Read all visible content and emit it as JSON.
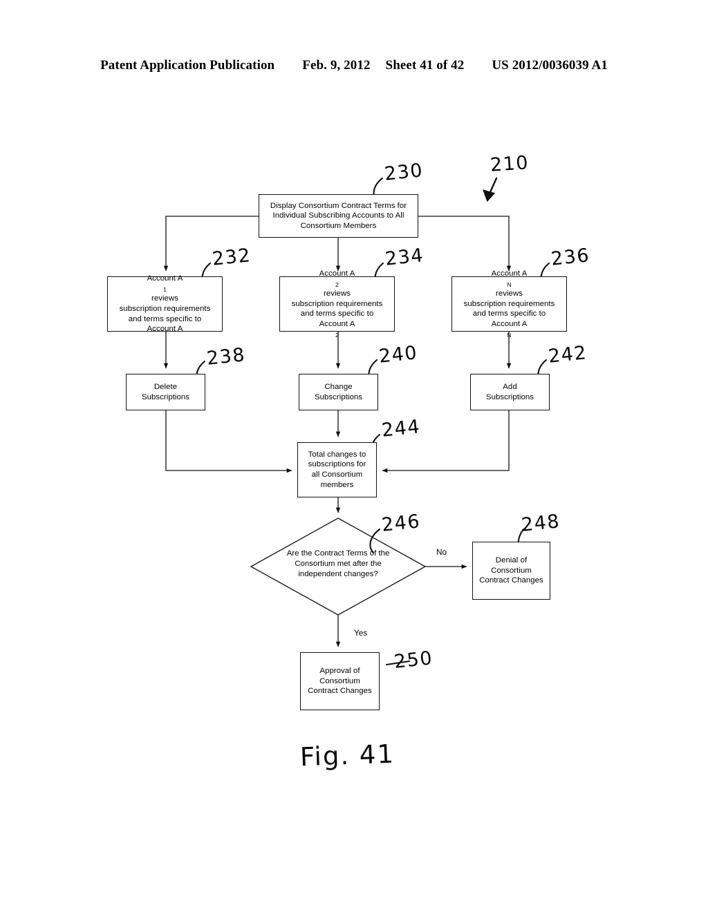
{
  "header": {
    "publication": "Patent Application Publication",
    "date": "Feb. 9, 2012",
    "sheet": "Sheet 41 of 42",
    "doc_number": "US 2012/0036039 A1"
  },
  "figure": {
    "caption": "Fig. 41",
    "overall_ref": "210",
    "nodes": {
      "n230": {
        "ref": "230",
        "line1": "Display Consortium Contract Terms for",
        "line2": "Individual Subscribing Accounts to All",
        "line3": "Consortium Members"
      },
      "n232": {
        "ref": "232",
        "line1_pre": "Account A",
        "line1_sub": "1",
        "line1_post": " reviews",
        "line2": "subscription requirements",
        "line3": "and terms specific to",
        "line4_pre": "Account A",
        "line4_sub": "",
        "line4_post": ""
      },
      "n234": {
        "ref": "234",
        "line1_pre": "Account A",
        "line1_sub": "2",
        "line1_post": " reviews",
        "line2": "subscription requirements",
        "line3": "and terms specific to",
        "line4_pre": "Account A",
        "line4_sub": "2",
        "line4_post": ""
      },
      "n236": {
        "ref": "236",
        "line1_pre": "Account A",
        "line1_sub": "N",
        "line1_post": " reviews",
        "line2": "subscription requirements",
        "line3": "and terms specific to",
        "line4_pre": "Account A",
        "line4_sub": "N",
        "line4_post": ""
      },
      "n238": {
        "ref": "238",
        "line1": "Delete",
        "line2": "Subscriptions"
      },
      "n240": {
        "ref": "240",
        "line1": "Change",
        "line2": "Subscriptions"
      },
      "n242": {
        "ref": "242",
        "line1": "Add",
        "line2": "Subscriptions"
      },
      "n244": {
        "ref": "244",
        "line1": "Total changes to",
        "line2": "subscriptions for",
        "line3": "all Consortium",
        "line4": "members"
      },
      "n246": {
        "ref": "246",
        "line1": "Are the Contract Terms of",
        "line2": "the Consortium met after the",
        "line3": "independent changes?"
      },
      "n248": {
        "ref": "248",
        "line1": "Denial of",
        "line2": "Consortium",
        "line3": "Contract Changes"
      },
      "n250": {
        "ref": "250",
        "line1": "Approval of",
        "line2": "Consortium",
        "line3": "Contract Changes"
      }
    },
    "edge_labels": {
      "no": "No",
      "yes": "Yes"
    },
    "colors": {
      "ink": "#111111",
      "background": "#ffffff"
    }
  }
}
